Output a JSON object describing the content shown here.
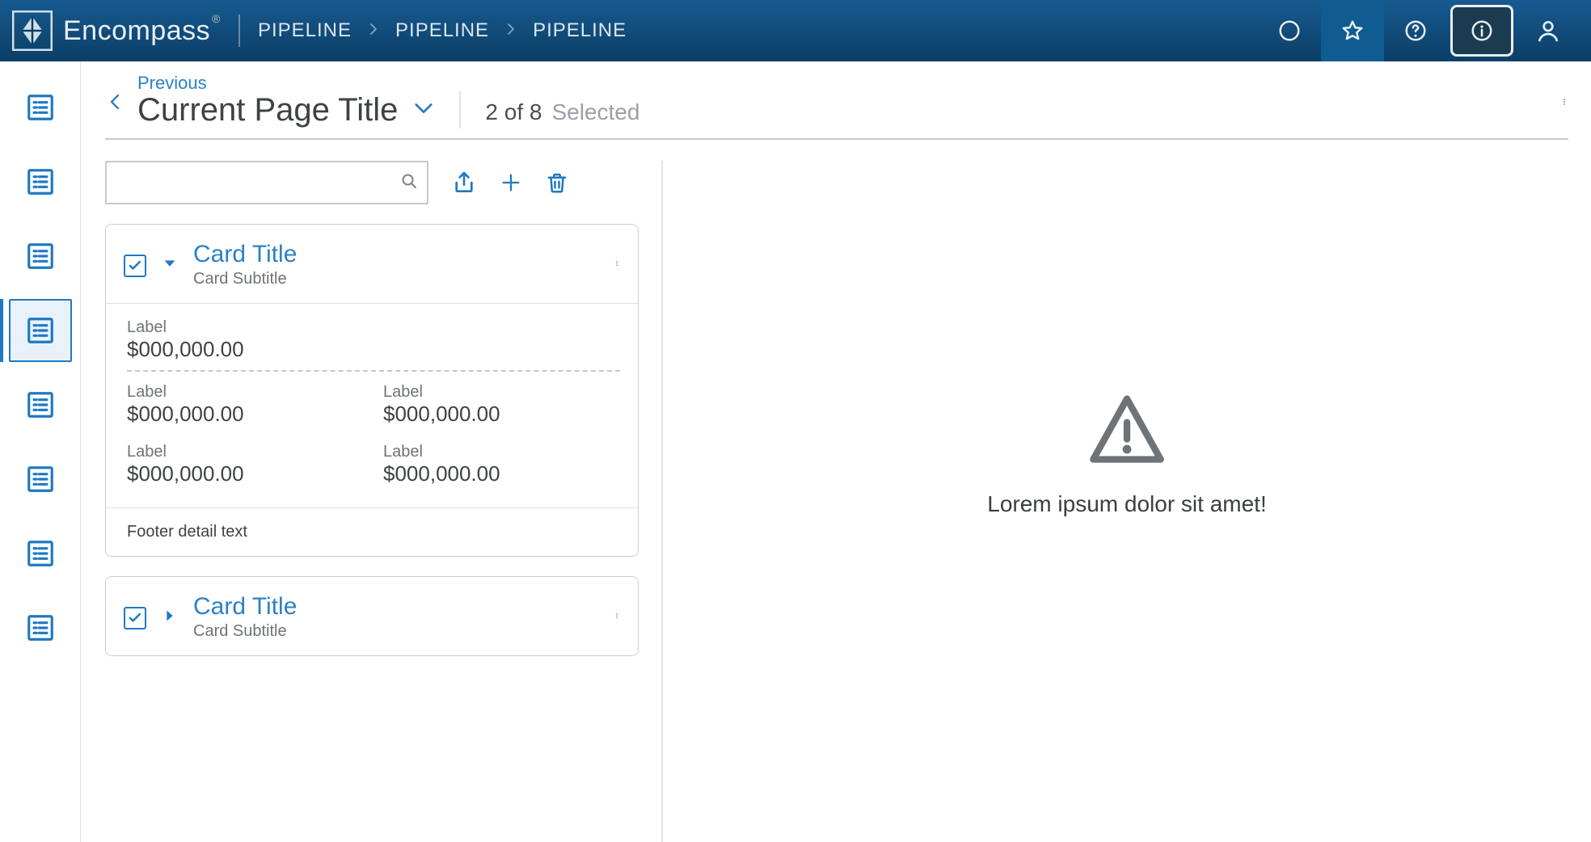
{
  "brand": {
    "name": "Encompass",
    "reg": "®"
  },
  "breadcrumbs": [
    "PIPELINE",
    "PIPELINE",
    "PIPELINE"
  ],
  "topbar_icons": {
    "circle": "status-circle-icon",
    "star": "star-icon",
    "help": "help-icon",
    "info": "info-icon",
    "user": "user-icon"
  },
  "rail": {
    "items": [
      {
        "id": "nav-1",
        "selected": false
      },
      {
        "id": "nav-2",
        "selected": false
      },
      {
        "id": "nav-3",
        "selected": false
      },
      {
        "id": "nav-4",
        "selected": true
      },
      {
        "id": "nav-5",
        "selected": false
      },
      {
        "id": "nav-6",
        "selected": false
      },
      {
        "id": "nav-7",
        "selected": false
      },
      {
        "id": "nav-8",
        "selected": false
      }
    ]
  },
  "header": {
    "previous_label": "Previous",
    "title": "Current Page Title",
    "count": "2 of 8",
    "count_suffix": "Selected"
  },
  "toolbar": {
    "search_placeholder": "",
    "actions": {
      "share": "share-icon",
      "add": "plus-icon",
      "delete": "trash-icon"
    }
  },
  "cards": [
    {
      "checked": true,
      "expanded": true,
      "title": "Card Title",
      "subtitle": "Card Subtitle",
      "primary": {
        "label": "Label",
        "value": "$000,000.00"
      },
      "grid": [
        {
          "label": "Label",
          "value": "$000,000.00"
        },
        {
          "label": "Label",
          "value": "$000,000.00"
        },
        {
          "label": "Label",
          "value": "$000,000.00"
        },
        {
          "label": "Label",
          "value": "$000,000.00"
        }
      ],
      "footer": "Footer detail text"
    },
    {
      "checked": true,
      "expanded": false,
      "title": "Card Title",
      "subtitle": "Card Subtitle"
    }
  ],
  "empty_state": {
    "message": "Lorem ipsum dolor sit amet!"
  },
  "colors": {
    "accent": "#1e79c3",
    "brand_bg": "#0c3e66"
  }
}
